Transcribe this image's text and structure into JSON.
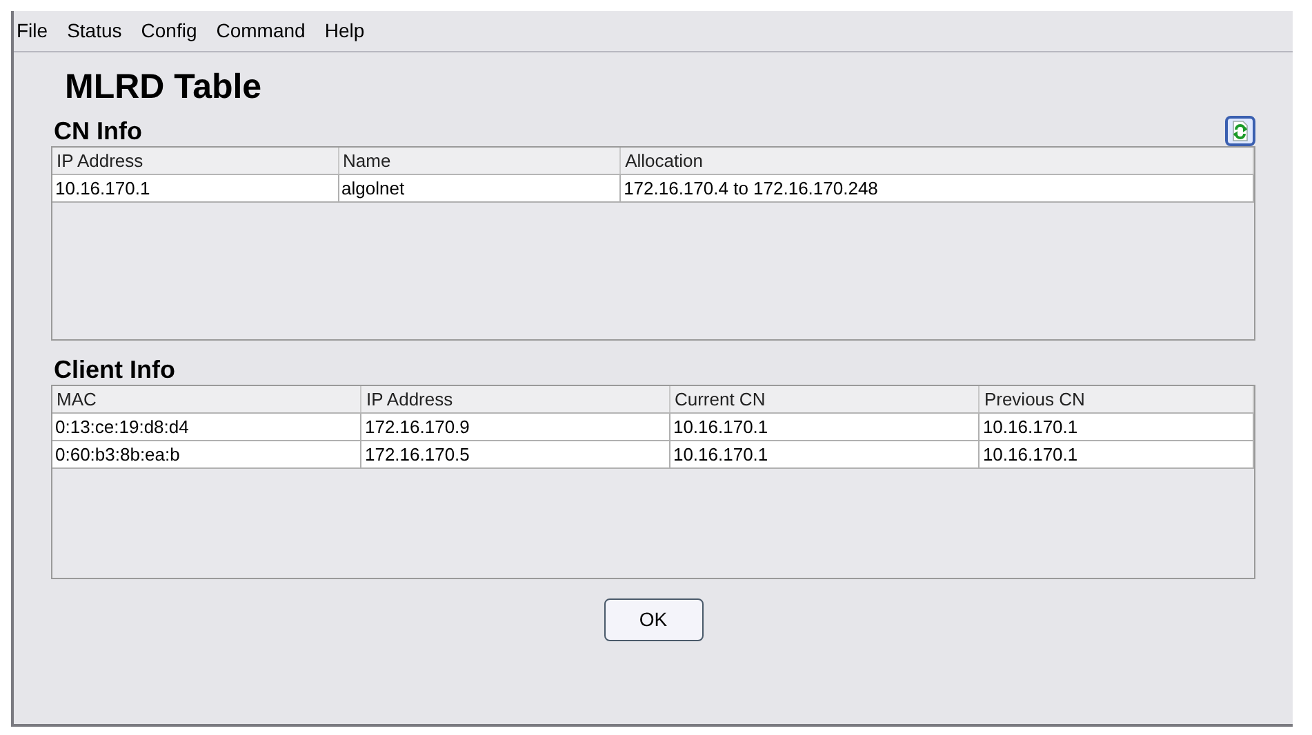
{
  "menu": [
    "File",
    "Status",
    "Config",
    "Command",
    "Help"
  ],
  "title": "MLRD Table",
  "sections": [
    {
      "heading": "CN Info",
      "columns": [
        "IP Address",
        "Name",
        "Allocation"
      ],
      "rows": [
        [
          "10.16.170.1",
          "algolnet",
          "172.16.170.4 to 172.16.170.248"
        ]
      ]
    },
    {
      "heading": "Client Info",
      "columns": [
        "MAC",
        "IP Address",
        "Current CN",
        "Previous CN"
      ],
      "rows": [
        [
          "0:13:ce:19:d8:d4",
          "172.16.170.9",
          "10.16.170.1",
          "10.16.170.1"
        ],
        [
          "0:60:b3:8b:ea:b",
          "172.16.170.5",
          "10.16.170.1",
          "10.16.170.1"
        ]
      ]
    }
  ],
  "ok_button": "OK"
}
